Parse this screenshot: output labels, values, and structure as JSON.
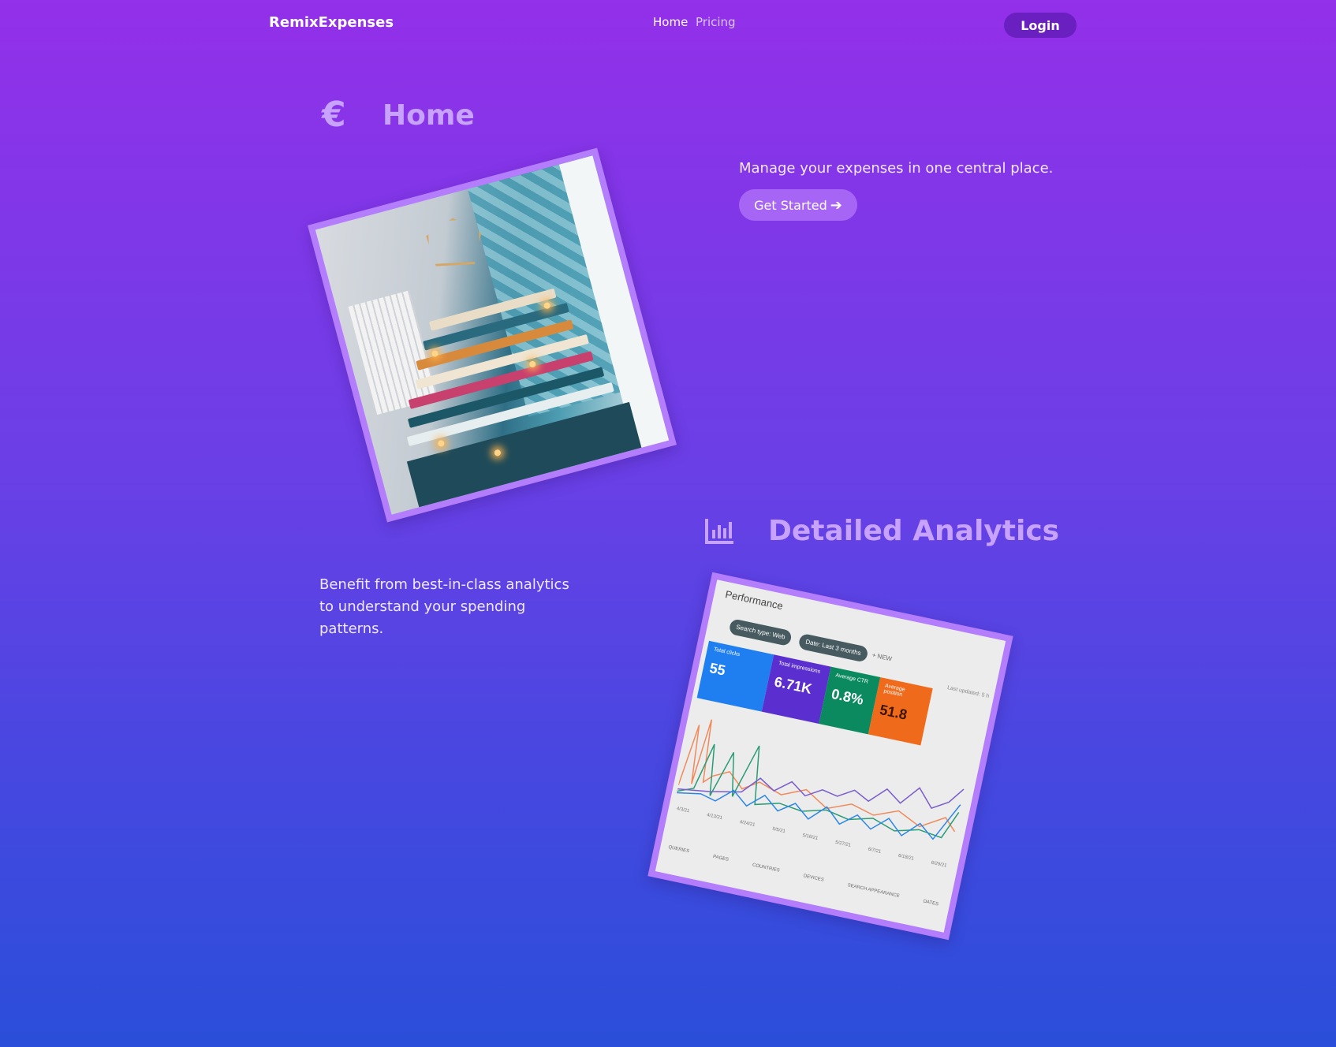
{
  "nav": {
    "brand": "RemixExpenses",
    "links": [
      {
        "label": "Home",
        "active": true
      },
      {
        "label": "Pricing",
        "active": false
      }
    ],
    "login_label": "Login"
  },
  "home": {
    "icon": "euro-icon",
    "title": "Home",
    "tagline": "Manage your expenses in one central place.",
    "cta_label": "Get Started",
    "cta_icon": "arrow-right-icon",
    "image": "books-photo"
  },
  "analytics": {
    "icon": "bar-chart-icon",
    "title": "Detailed Analytics",
    "description": "Benefit from best-in-class analytics to understand your spending patterns.",
    "image": "analytics-dashboard-photo",
    "screenshot": {
      "title": "Performance",
      "chips": [
        "Search type: Web",
        "Date: Last 3 months"
      ],
      "new_label": "+ NEW",
      "updated": "Last updated: 5 h",
      "metrics": [
        {
          "label": "Total clicks",
          "value": "55"
        },
        {
          "label": "Total impressions",
          "value": "6.71K"
        },
        {
          "label": "Average CTR",
          "value": "0.8%"
        },
        {
          "label": "Average position",
          "value": "51.8"
        }
      ],
      "dates": [
        "4/3/21",
        "4/13/21",
        "4/24/21",
        "5/5/21",
        "5/16/21",
        "5/27/21",
        "6/7/21",
        "6/18/21",
        "6/29/21"
      ],
      "tabs": [
        "QUERIES",
        "PAGES",
        "COUNTRIES",
        "DEVICES",
        "SEARCH APPEARANCE",
        "DATES"
      ]
    }
  },
  "colors": {
    "gradient_top": "#9330e9",
    "gradient_bottom": "#2a4ed9",
    "accent": "#c7a2ff",
    "login_bg": "#6a1fc1",
    "cta_bg": "#a765f5",
    "frame": "#b37dfc"
  }
}
